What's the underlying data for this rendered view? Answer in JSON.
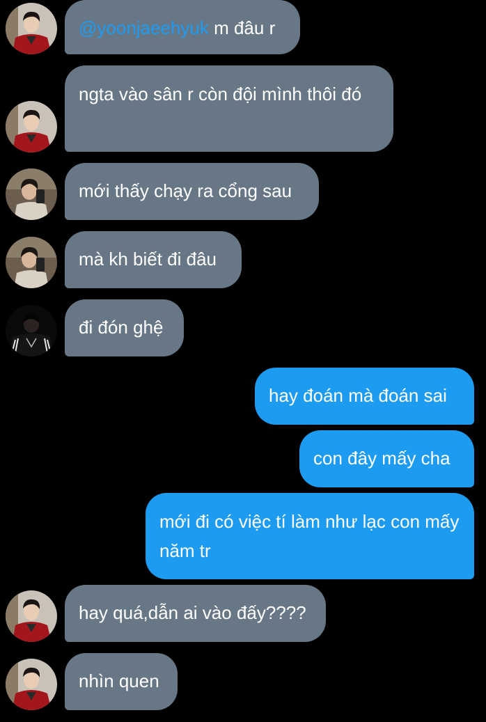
{
  "messages": [
    {
      "side": "in",
      "avatar": "user-red-jacket",
      "mention": "@yoonjaeehyuk",
      "text": " m đâu r"
    },
    {
      "side": "in",
      "avatar": "user-red-jacket",
      "text": "ngta vào sân r còn đội mình thôi đó"
    },
    {
      "side": "in",
      "avatar": "user-mirror-selfie",
      "text": "mới thấy chạy ra cổng sau"
    },
    {
      "side": "in",
      "avatar": "user-mirror-selfie",
      "text": "mà kh biết đi đâu"
    },
    {
      "side": "in",
      "avatar": "user-dark-track-jacket",
      "text": "đi đón ghệ"
    },
    {
      "side": "out",
      "text": "hay đoán mà đoán sai"
    },
    {
      "side": "out",
      "text": "con đây mấy cha"
    },
    {
      "side": "out",
      "text": "mới đi có việc tí làm như lạc con mấy năm tr"
    },
    {
      "side": "in",
      "avatar": "user-red-jacket",
      "text": "hay quá,dẫn ai vào đấy????"
    },
    {
      "side": "in",
      "avatar": "user-red-jacket",
      "text": "nhìn quen"
    }
  ],
  "colors": {
    "background": "#000000",
    "incoming_bubble": "#687785",
    "outgoing_bubble": "#1d9bf0",
    "mention": "#1d9bf0",
    "text": "#ffffff"
  }
}
